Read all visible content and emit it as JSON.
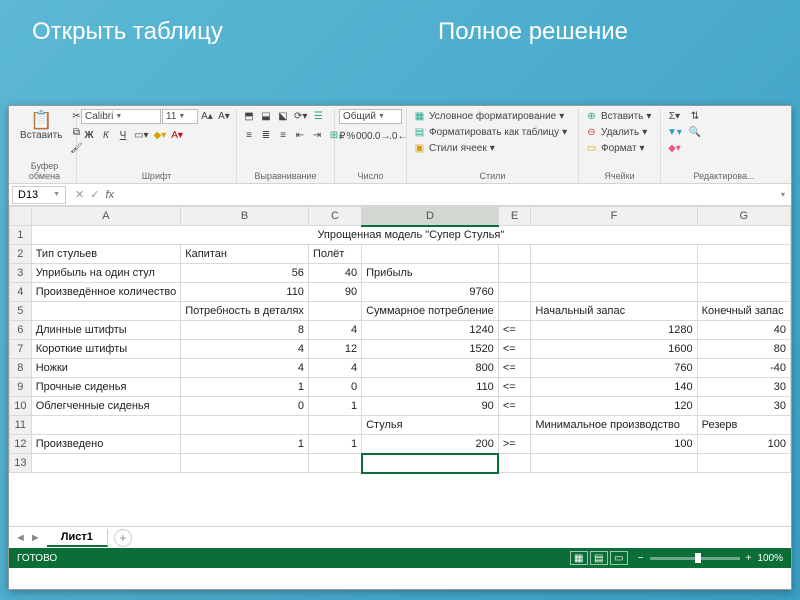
{
  "banner": {
    "left": "Открыть таблицу",
    "right": "Полное решение"
  },
  "ribbon": {
    "paste": "Вставить",
    "font_name": "Calibri",
    "font_size": "11",
    "bold": "Ж",
    "italic": "К",
    "underline": "Ч",
    "number_format": "Общий",
    "cond_fmt": "Условное форматирование",
    "as_table": "Форматировать как таблицу",
    "cell_styles": "Стили ячеек",
    "insert": "Вставить",
    "delete": "Удалить",
    "format": "Формат",
    "g_clipboard": "Буфер обмена",
    "g_font": "Шрифт",
    "g_align": "Выравнивание",
    "g_number": "Число",
    "g_styles": "Стили",
    "g_cells": "Ячейки",
    "g_editing": "Редактирова..."
  },
  "namebox": "D13",
  "formula": "",
  "cols": [
    "A",
    "B",
    "C",
    "D",
    "E",
    "F",
    "G"
  ],
  "rows": [
    {
      "n": "1",
      "A": "",
      "B": "",
      "C": "",
      "D": "Упрощенная модель \"Супер Стулья\"",
      "E": "",
      "F": "",
      "G": "",
      "merge": "title"
    },
    {
      "n": "2",
      "A": "Тип стульев",
      "B": "Капитан",
      "C": "Полёт",
      "D": "",
      "E": "",
      "F": "",
      "G": ""
    },
    {
      "n": "3",
      "A": "Уприбыль на один стул",
      "B": "56",
      "C": "40",
      "D": "Прибыль",
      "E": "",
      "F": "",
      "G": ""
    },
    {
      "n": "4",
      "A": "Произведённое количество",
      "B": "110",
      "C": "90",
      "D": "9760",
      "E": "",
      "F": "",
      "G": ""
    },
    {
      "n": "5",
      "A": "",
      "B": "Потребность в деталях",
      "C": "",
      "D": "Суммарное потребление",
      "E": "",
      "F": "Начальный запас",
      "G": "Конечный запас"
    },
    {
      "n": "6",
      "A": "Длинные штифты",
      "B": "8",
      "C": "4",
      "D": "1240",
      "E": "<=",
      "F": "1280",
      "G": "40"
    },
    {
      "n": "7",
      "A": "Короткие штифты",
      "B": "4",
      "C": "12",
      "D": "1520",
      "E": "<=",
      "F": "1600",
      "G": "80"
    },
    {
      "n": "8",
      "A": "Ножки",
      "B": "4",
      "C": "4",
      "D": "800",
      "E": "<=",
      "F": "760",
      "G": "-40"
    },
    {
      "n": "9",
      "A": "Прочные сиденья",
      "B": "1",
      "C": "0",
      "D": "110",
      "E": "<=",
      "F": "140",
      "G": "30"
    },
    {
      "n": "10",
      "A": "Облегченные сиденья",
      "B": "0",
      "C": "1",
      "D": "90",
      "E": "<=",
      "F": "120",
      "G": "30"
    },
    {
      "n": "11",
      "A": "",
      "B": "",
      "C": "",
      "D": "Стулья",
      "E": "",
      "F": "Минимальное производство",
      "G": "Резерв"
    },
    {
      "n": "12",
      "A": "Произведено",
      "B": "1",
      "C": "1",
      "D": "200",
      "E": ">=",
      "F": "100",
      "G": "100"
    },
    {
      "n": "13",
      "A": "",
      "B": "",
      "C": "",
      "D": "",
      "E": "",
      "F": "",
      "G": ""
    }
  ],
  "sheet": "Лист1",
  "status": {
    "ready": "ГОТОВО",
    "zoom": "100%"
  }
}
